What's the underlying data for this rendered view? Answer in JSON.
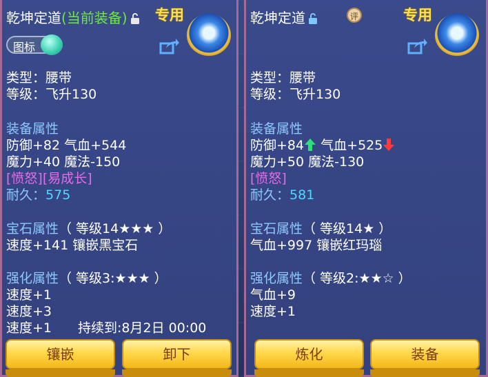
{
  "left": {
    "name": "乾坤定道",
    "current_tag": "(当前装备)",
    "exclusive": "专用",
    "icon_toggle_label": "图标",
    "type_line": "类型：腰带",
    "level_line": "等级：飞升130",
    "attr_header": "装备属性",
    "attr_line1": "防御+82 气血+544",
    "attr_line2": "魔力+40 魔法-150",
    "special": "[愤怒][易成长]",
    "durability_label": "耐久：",
    "durability_value": "575",
    "gem_header": "宝石属性",
    "gem_level": "（ 等级14★★★ ）",
    "gem_line": "速度+141 镶嵌黑宝石",
    "enh_header": "强化属性",
    "enh_level": "（ 等级3:★★★ ）",
    "enh_line1": "速度+1",
    "enh_line2": "速度+3",
    "enh_line3": "速度+1",
    "enh_duration": "持续到:8月2日 00:00",
    "button1": "镶嵌",
    "button2": "卸下"
  },
  "right": {
    "name": "乾坤定道",
    "eval_badge": "评",
    "exclusive": "专用",
    "type_line": "类型：腰带",
    "level_line": "等级：飞升130",
    "attr_header": "装备属性",
    "attr_def": "防御+84",
    "attr_hp": "气血+525",
    "attr_line2": "魔力+50 魔法-130",
    "special": "[愤怒]",
    "durability_label": "耐久：",
    "durability_value": "581",
    "gem_header": "宝石属性",
    "gem_level": "（ 等级14★ ）",
    "gem_line": "气血+997 镶嵌红玛瑙",
    "enh_header": "强化属性",
    "enh_level": "（ 等级2:★★☆ ）",
    "enh_line1": "气血+9",
    "enh_line2": "速度+1",
    "button1": "炼化",
    "button2": "装备"
  },
  "icons": [
    "lock-icon",
    "share-icon",
    "belt-item-icon",
    "toggle-knob-icon",
    "up-arrow-icon",
    "down-arrow-icon"
  ],
  "colors": {
    "panel_border": "#a56a96",
    "current_tag": "#6eea3b",
    "header_blue": "#8ec8ff",
    "special_purple": "#e86ae8",
    "durability_cyan": "#4fd9ff",
    "exclusive_gold": "#ffe24a",
    "button_gold": "#ffd84a",
    "up_green": "#2ee07a",
    "down_red": "#ff3b3b"
  }
}
